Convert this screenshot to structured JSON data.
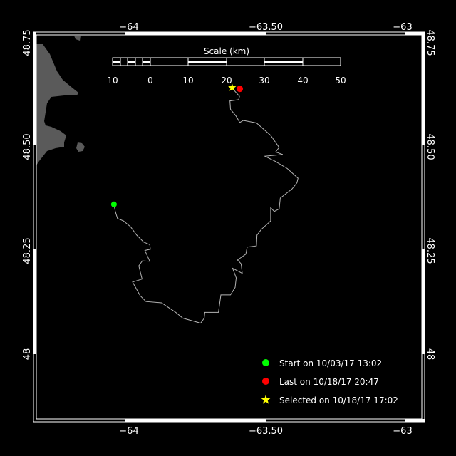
{
  "colors": {
    "background": "#000000",
    "land": "#5a5a5a",
    "track": "#b4b4b4",
    "start": "#00ff00",
    "last": "#ff0000",
    "selected": "#ffff00",
    "frame": "#ffffff"
  },
  "axes": {
    "lon_ticks": [
      {
        "value": -64,
        "label": "−64"
      },
      {
        "value": -63.5,
        "label": "−63.50"
      },
      {
        "value": -63,
        "label": "−63"
      }
    ],
    "lat_ticks": [
      {
        "value": 48.75,
        "label": "48.75"
      },
      {
        "value": 48.5,
        "label": "48.50"
      },
      {
        "value": 48.25,
        "label": "48.25"
      },
      {
        "value": 48,
        "label": "48"
      }
    ]
  },
  "scale_bar": {
    "title": "Scale (km)",
    "labels": [
      "10",
      "0",
      "10",
      "20",
      "30",
      "40",
      "50"
    ]
  },
  "legend": {
    "start": {
      "label": "Start on 10/03/17 13:02",
      "icon": "green-circle"
    },
    "last": {
      "label": "Last on 10/18/17 20:47",
      "icon": "red-circle"
    },
    "selected": {
      "label": "Selected on 10/18/17 17:02",
      "icon": "yellow-star"
    }
  },
  "markers": {
    "start": {
      "lon": -64.055,
      "lat": 48.361
    },
    "last": {
      "lon": -63.595,
      "lat": 48.639
    },
    "selected": {
      "lon": -63.623,
      "lat": 48.642
    }
  },
  "track": [
    [
      -64.055,
      48.361
    ],
    [
      -64.05,
      48.344
    ],
    [
      -64.042,
      48.327
    ],
    [
      -64.02,
      48.321
    ],
    [
      -63.994,
      48.307
    ],
    [
      -63.972,
      48.287
    ],
    [
      -63.946,
      48.27
    ],
    [
      -63.924,
      48.264
    ],
    [
      -63.922,
      48.253
    ],
    [
      -63.942,
      48.25
    ],
    [
      -63.924,
      48.224
    ],
    [
      -63.951,
      48.225
    ],
    [
      -63.964,
      48.213
    ],
    [
      -63.952,
      48.181
    ],
    [
      -63.987,
      48.174
    ],
    [
      -63.959,
      48.141
    ],
    [
      -63.938,
      48.127
    ],
    [
      -63.881,
      48.124
    ],
    [
      -63.829,
      48.101
    ],
    [
      -63.803,
      48.087
    ],
    [
      -63.738,
      48.075
    ],
    [
      -63.725,
      48.087
    ],
    [
      -63.723,
      48.101
    ],
    [
      -63.673,
      48.101
    ],
    [
      -63.664,
      48.143
    ],
    [
      -63.629,
      48.143
    ],
    [
      -63.612,
      48.161
    ],
    [
      -63.608,
      48.184
    ],
    [
      -63.621,
      48.207
    ],
    [
      -63.586,
      48.195
    ],
    [
      -63.59,
      48.218
    ],
    [
      -63.603,
      48.227
    ],
    [
      -63.573,
      48.241
    ],
    [
      -63.568,
      48.258
    ],
    [
      -63.534,
      48.261
    ],
    [
      -63.532,
      48.287
    ],
    [
      -63.516,
      48.301
    ],
    [
      -63.482,
      48.321
    ],
    [
      -63.482,
      48.353
    ],
    [
      -63.469,
      48.344
    ],
    [
      -63.451,
      48.35
    ],
    [
      -63.447,
      48.376
    ],
    [
      -63.404,
      48.398
    ],
    [
      -63.386,
      48.413
    ],
    [
      -63.382,
      48.424
    ],
    [
      -63.421,
      48.447
    ],
    [
      -63.464,
      48.464
    ],
    [
      -63.503,
      48.477
    ],
    [
      -63.438,
      48.481
    ],
    [
      -63.464,
      48.487
    ],
    [
      -63.451,
      48.498
    ],
    [
      -63.482,
      48.527
    ],
    [
      -63.534,
      48.557
    ],
    [
      -63.582,
      48.563
    ],
    [
      -63.595,
      48.558
    ],
    [
      -63.608,
      48.573
    ],
    [
      -63.629,
      48.59
    ],
    [
      -63.631,
      48.61
    ],
    [
      -63.599,
      48.613
    ],
    [
      -63.596,
      48.621
    ],
    [
      -63.622,
      48.64
    ]
  ]
}
